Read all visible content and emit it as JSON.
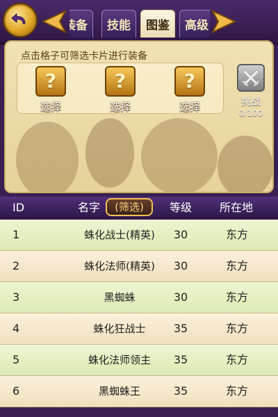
{
  "tabs": [
    "装备",
    "技能",
    "图鉴",
    "高级"
  ],
  "active_tab_index": 2,
  "panel": {
    "hint": "点击格子可筛选卡片进行装备",
    "slots": [
      {
        "label": "选择",
        "icon": "question-mark-icon"
      },
      {
        "label": "选择",
        "icon": "question-mark-icon"
      },
      {
        "label": "选择",
        "icon": "question-mark-icon"
      }
    ],
    "challenge": {
      "label": "挑战",
      "count": "0/100",
      "icon": "crossed-swords-icon"
    }
  },
  "table": {
    "headers": {
      "id": "ID",
      "name": "名字",
      "filter": "(筛选)",
      "level": "等级",
      "location": "所在地"
    },
    "rows": [
      {
        "id": "1",
        "name": "蛛化战士(精英)",
        "level": "30",
        "location": "东方"
      },
      {
        "id": "2",
        "name": "蛛化法师(精英)",
        "level": "30",
        "location": "东方"
      },
      {
        "id": "3",
        "name": "黑蜘蛛",
        "level": "30",
        "location": "东方"
      },
      {
        "id": "4",
        "name": "蛛化狂战士",
        "level": "35",
        "location": "东方"
      },
      {
        "id": "5",
        "name": "蛛化法师领主",
        "level": "35",
        "location": "东方"
      },
      {
        "id": "6",
        "name": "黑蜘蛛王",
        "level": "35",
        "location": "东方"
      }
    ]
  },
  "colors": {
    "accent": "#f4c35a",
    "header_purple": "#3a1f52",
    "row_green": "#e4efc2",
    "row_cream": "#f6e8c8"
  }
}
